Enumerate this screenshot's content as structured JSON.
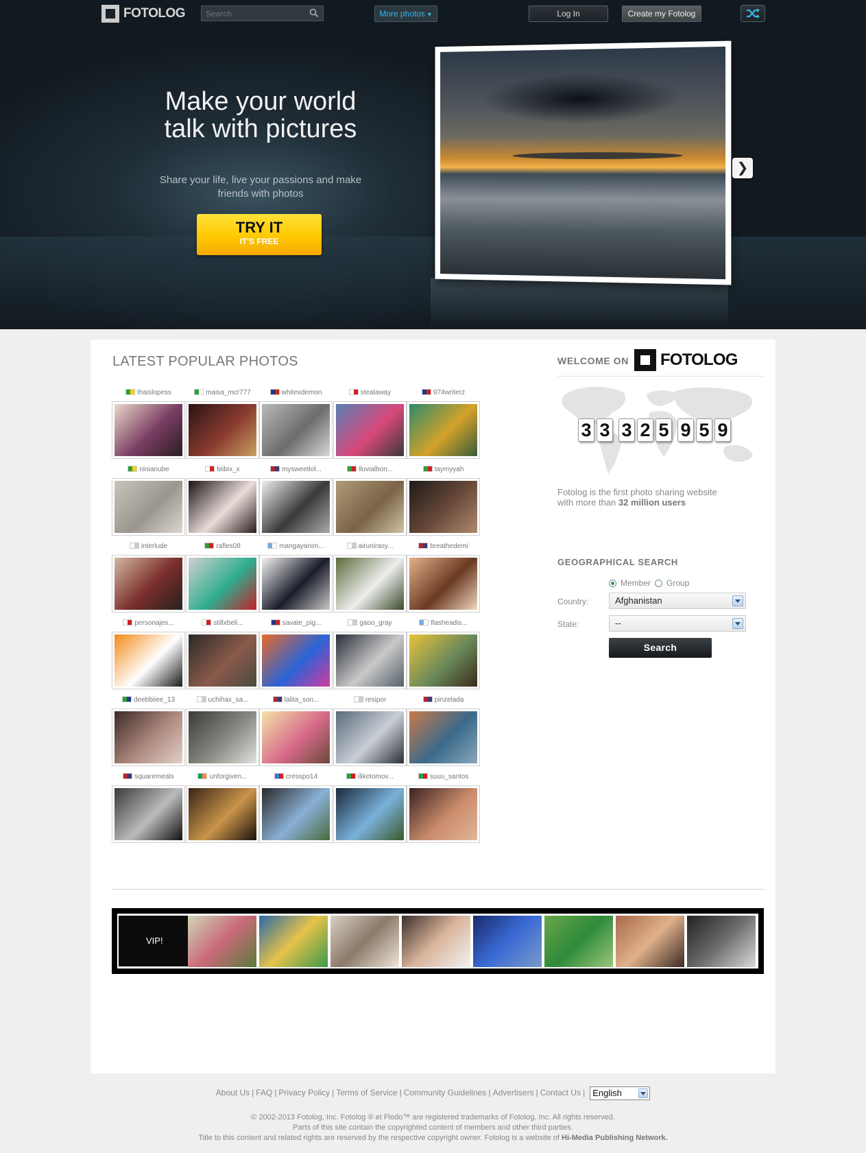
{
  "header": {
    "logo_text": "FOTOLOG",
    "search_placeholder": "Search",
    "more_photos": "More photos",
    "login": "Log In",
    "create": "Create my Fotolog"
  },
  "hero": {
    "headline_line1": "Make your world",
    "headline_line2": "talk with pictures",
    "sub_line1": "Share your life, live your passions and make",
    "sub_line2": "friends with photos",
    "try_main": "TRY IT",
    "try_sub": "IT'S FREE",
    "next_glyph": "❯"
  },
  "popular": {
    "title": "LATEST POPULAR PHOTOS",
    "photos": [
      {
        "user": "thaislopess",
        "flag": [
          "#2e9e3a",
          "#f7d117"
        ],
        "thumb": [
          "#e9d9c9",
          "#7a3d64",
          "#2b1e20"
        ]
      },
      {
        "user": "maisa_mcr777",
        "flag": [
          "#2e9e3a",
          "#ffffff"
        ],
        "thumb": [
          "#2a1414",
          "#8a3b2f",
          "#c9a062"
        ]
      },
      {
        "user": "whitexdemon",
        "flag": [
          "#1f3b8a",
          "#d02020"
        ],
        "thumb": [
          "#b8b8b8",
          "#6d6d6d",
          "#d9d9d9"
        ]
      },
      {
        "user": "stealaway",
        "flag": [
          "#ffffff",
          "#d02020"
        ],
        "thumb": [
          "#5a7fb5",
          "#d7487a",
          "#3a3a3a"
        ]
      },
      {
        "user": "974writerz",
        "flag": [
          "#1f3b8a",
          "#d02020"
        ],
        "thumb": [
          "#2e8a6a",
          "#d3a22a",
          "#3a5a3a"
        ]
      },
      {
        "user": "ninianube",
        "flag": [
          "#2e9e3a",
          "#f7d117"
        ],
        "thumb": [
          "#c9c4bc",
          "#9a958d",
          "#dcd7cf"
        ]
      },
      {
        "user": "biibix_x",
        "flag": [
          "#ffffff",
          "#d02020"
        ],
        "thumb": [
          "#1a1414",
          "#e9dcd9",
          "#2a1e1e"
        ]
      },
      {
        "user": "mysweetlol...",
        "flag": [
          "#b22234",
          "#3c3b6e"
        ],
        "thumb": [
          "#eeeeee",
          "#3a3a3a",
          "#aaaaaa"
        ]
      },
      {
        "user": "lluvialbon...",
        "flag": [
          "#2e9e3a",
          "#d02020"
        ],
        "thumb": [
          "#b09b7a",
          "#7a6347",
          "#cfc3a5"
        ]
      },
      {
        "user": "taymyyah",
        "flag": [
          "#2e9e3a",
          "#d02020"
        ],
        "thumb": [
          "#1e1a18",
          "#6a4a3a",
          "#b08a70"
        ]
      },
      {
        "user": "interlude",
        "flag": [
          "#ffffff",
          "#cccccc"
        ],
        "thumb": [
          "#d3b6a1",
          "#7a2d2a",
          "#262220"
        ]
      },
      {
        "user": "rafles08",
        "flag": [
          "#2e9e3a",
          "#d02020"
        ],
        "thumb": [
          "#d0d0d0",
          "#2fae8e",
          "#c2202a"
        ]
      },
      {
        "user": "mangayanim...",
        "flag": [
          "#74acdf",
          "#ffffff"
        ],
        "thumb": [
          "#f2f2f2",
          "#1b1d2a",
          "#c9c9c9"
        ]
      },
      {
        "user": "airunirasy...",
        "flag": [
          "#ffffff",
          "#cccccc"
        ],
        "thumb": [
          "#5a6a3a",
          "#eeeeee",
          "#3a4a2a"
        ]
      },
      {
        "user": "breathedemi",
        "flag": [
          "#b22234",
          "#3c3b6e"
        ],
        "thumb": [
          "#e3b18a",
          "#6a3a22",
          "#f0d7be"
        ]
      },
      {
        "user": "personajes...",
        "flag": [
          "#ffffff",
          "#d02020"
        ],
        "thumb": [
          "#f28a1a",
          "#ffffff",
          "#1a1a1a"
        ]
      },
      {
        "user": "stillxbeli...",
        "flag": [
          "#ffffff",
          "#d02020"
        ],
        "thumb": [
          "#2a2a28",
          "#8a5a4a",
          "#4a4a40"
        ]
      },
      {
        "user": "savate_pig...",
        "flag": [
          "#1f3b8a",
          "#d02020"
        ],
        "thumb": [
          "#e96a2a",
          "#2a64d6",
          "#d23aa0"
        ]
      },
      {
        "user": "gaoo_gray",
        "flag": [
          "#ffffff",
          "#cccccc"
        ],
        "thumb": [
          "#2a2e3a",
          "#c9c9c9",
          "#55606a"
        ]
      },
      {
        "user": "flasheadis...",
        "flag": [
          "#74acdf",
          "#ffffff"
        ],
        "thumb": [
          "#e8c23a",
          "#6a8a5a",
          "#3a2a1a"
        ]
      },
      {
        "user": "deebbiiee_13",
        "flag": [
          "#2e9e3a",
          "#1f3b8a"
        ],
        "thumb": [
          "#3a2a26",
          "#b08a80",
          "#e0d0c8"
        ]
      },
      {
        "user": "uchihax_sa...",
        "flag": [
          "#ffffff",
          "#cccccc"
        ],
        "thumb": [
          "#3a3a36",
          "#8a8a84",
          "#e2e2de"
        ]
      },
      {
        "user": "lalita_son...",
        "flag": [
          "#b22234",
          "#3c3b6e"
        ],
        "thumb": [
          "#f5e2a8",
          "#d76a8a",
          "#6a4a3a"
        ]
      },
      {
        "user": "resipor",
        "flag": [
          "#ffffff",
          "#cccccc"
        ],
        "thumb": [
          "#5a6a7a",
          "#c9ced6",
          "#2a2e36"
        ]
      },
      {
        "user": "pinzelada",
        "flag": [
          "#b22234",
          "#3c3b6e"
        ],
        "thumb": [
          "#c97a4a",
          "#3a6a8a",
          "#8aa6ba"
        ]
      },
      {
        "user": "squaremeals",
        "flag": [
          "#b22234",
          "#3c3b6e"
        ],
        "thumb": [
          "#3a3a3a",
          "#bbbbbb",
          "#111111"
        ]
      },
      {
        "user": "unforgiven...",
        "flag": [
          "#169b62",
          "#ff883e"
        ],
        "thumb": [
          "#3a2418",
          "#c9944a",
          "#1a120c"
        ]
      },
      {
        "user": "cresspo14",
        "flag": [
          "#3a7ad6",
          "#d02020"
        ],
        "thumb": [
          "#2a2a2a",
          "#8ab0d6",
          "#4a6a3a"
        ]
      },
      {
        "user": "iliketomov...",
        "flag": [
          "#2e9e3a",
          "#d02020"
        ],
        "thumb": [
          "#1a2a3a",
          "#7ab0da",
          "#3a5a2a"
        ]
      },
      {
        "user": "suuu_santos",
        "flag": [
          "#2e9e3a",
          "#d02020"
        ],
        "thumb": [
          "#3a2222",
          "#c98a6a",
          "#e2b69a"
        ]
      }
    ]
  },
  "vip": {
    "label": "VIP!",
    "photos": [
      {
        "thumb": [
          "#cfd6b6",
          "#c96a7a",
          "#5a7a3a"
        ]
      },
      {
        "thumb": [
          "#2a6aa6",
          "#e6c24a",
          "#3a9a4a"
        ]
      },
      {
        "thumb": [
          "#d9cfc3",
          "#8a7a6a",
          "#f0e6da"
        ]
      },
      {
        "thumb": [
          "#3a2e2a",
          "#d9b49a",
          "#f2f2f2"
        ]
      },
      {
        "thumb": [
          "#1a2a6a",
          "#3a6ad6",
          "#7a9ac6"
        ]
      },
      {
        "thumb": [
          "#6aa64a",
          "#2e8a3a",
          "#9ac67a"
        ]
      },
      {
        "thumb": [
          "#a66a4a",
          "#e0b08a",
          "#3a2a22"
        ]
      },
      {
        "thumb": [
          "#222222",
          "#6a6a6a",
          "#d9d9d9"
        ]
      }
    ]
  },
  "welcome": {
    "title": "WELCOME ON",
    "logo_text": "FOTOLOG",
    "counter_digits": [
      "3",
      "3",
      "3",
      "2",
      "5",
      "9",
      "5",
      "9"
    ],
    "about_prefix": "Fotolog is the first photo sharing website",
    "about_line2_prefix": "with more than",
    "about_bold": "32 million users"
  },
  "geo": {
    "title": "GEOGRAPHICAL SEARCH",
    "option_member": "Member",
    "option_group": "Group",
    "country_label": "Country:",
    "country_value": "Afghanistan",
    "state_label": "State:",
    "state_value": "--",
    "search_button": "Search"
  },
  "footer": {
    "links": [
      "About Us",
      "FAQ",
      "Privacy Policy",
      "Terms of Service",
      "Community Guidelines",
      "Advertisers",
      "Contact Us"
    ],
    "language": "English",
    "copyright_line1": "© 2002-2013 Fotolog, Inc. Fotolog ® et Flodo™ are registered trademarks of Fotolog, Inc. All rights reserved.",
    "copyright_line2": "Parts of this site contain the copyrighted content of members and other third parties.",
    "copyright_line3_prefix": "Title to this content and related rights are reserved by the respective copyright owner. Fotolog is a website of",
    "copyright_line3_bold": "Hi-Media Publishing Network."
  }
}
